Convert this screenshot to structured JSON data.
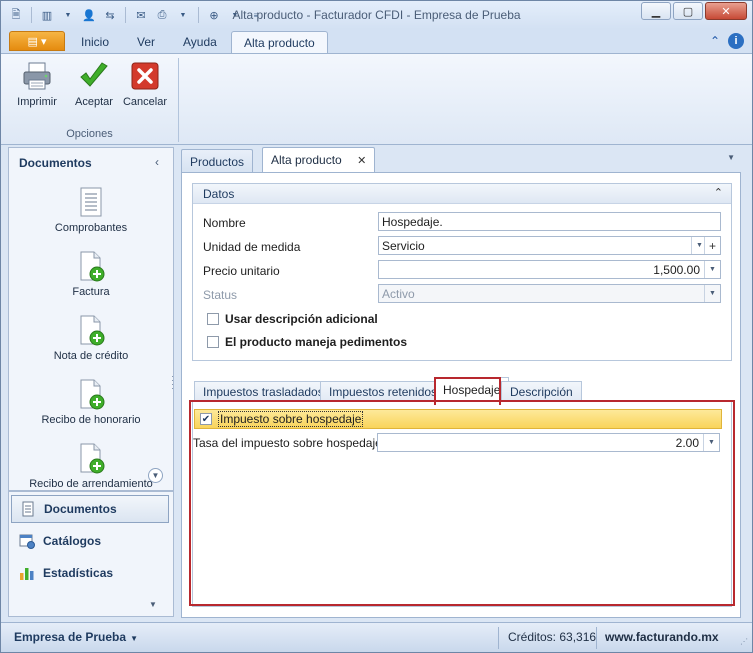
{
  "window": {
    "title": "Alta producto - Facturador CFDI - Empresa de Prueba"
  },
  "ribbon": {
    "tabs": [
      {
        "label": "Inicio"
      },
      {
        "label": "Ver"
      },
      {
        "label": "Ayuda"
      },
      {
        "label": "Alta producto"
      }
    ],
    "active_tab": "Alta producto",
    "buttons": {
      "print": "Imprimir",
      "accept": "Aceptar",
      "cancel": "Cancelar"
    },
    "group_label": "Opciones"
  },
  "nav": {
    "header": "Documentos",
    "items": [
      {
        "label": "Comprobantes",
        "icon": "document-list-icon"
      },
      {
        "label": "Factura",
        "icon": "document-add-icon"
      },
      {
        "label": "Nota de crédito",
        "icon": "document-add-icon"
      },
      {
        "label": "Recibo de honorario",
        "icon": "document-add-icon"
      },
      {
        "label": "Recibo de arrendamiento",
        "icon": "document-add-icon"
      }
    ],
    "sections": [
      {
        "label": "Documentos",
        "active": true
      },
      {
        "label": "Catálogos",
        "active": false
      },
      {
        "label": "Estadísticas",
        "active": false
      }
    ]
  },
  "doc_tabs": [
    {
      "label": "Productos",
      "active": false
    },
    {
      "label": "Alta producto",
      "active": true
    }
  ],
  "datos": {
    "header": "Datos",
    "fields": {
      "nombre": {
        "label": "Nombre",
        "value": "Hospedaje."
      },
      "unidad": {
        "label": "Unidad de medida",
        "value": "Servicio"
      },
      "precio": {
        "label": "Precio unitario",
        "value": "1,500.00"
      },
      "status": {
        "label": "Status",
        "value": "Activo"
      }
    },
    "checks": {
      "descripcion": {
        "label": "Usar descripción adicional",
        "checked": false
      },
      "pedimentos": {
        "label": "El producto maneja pedimentos",
        "checked": false
      }
    }
  },
  "inner_tabs": [
    {
      "label": "Impuestos trasladados"
    },
    {
      "label": "Impuestos retenidos"
    },
    {
      "label": "Hospedaje"
    },
    {
      "label": "Descripción"
    }
  ],
  "inner_active": "Hospedaje",
  "hospedaje": {
    "check_label": "Impuesto sobre hospedaje",
    "checked": true,
    "tasa_label": "Tasa del impuesto sobre hospedaje",
    "tasa_value": "2.00"
  },
  "status": {
    "company": "Empresa de Prueba",
    "credits": "Créditos: 63,316",
    "site": "www.facturando.mx"
  },
  "colors": {
    "accent_orange": "#e58b0f",
    "highlight_frame": "#b8282e",
    "highlight_row": "#f9d45b"
  }
}
